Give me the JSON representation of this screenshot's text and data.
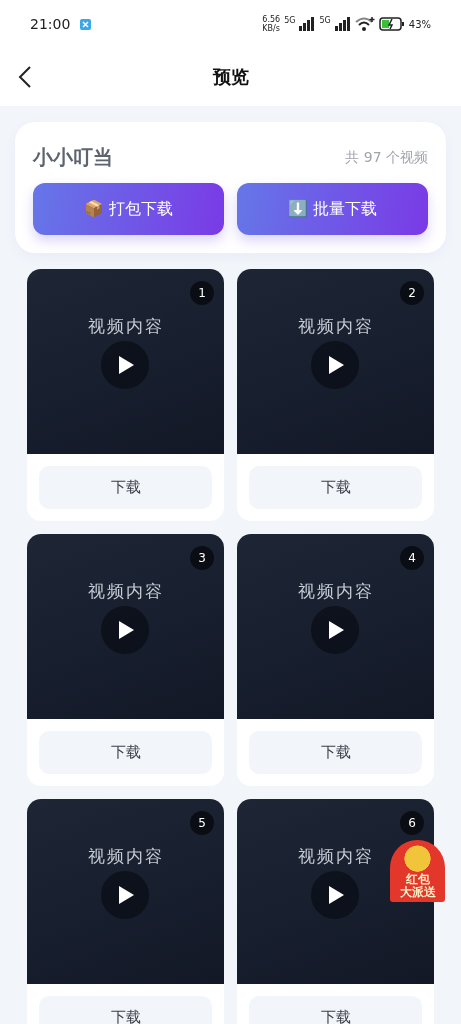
{
  "status_bar": {
    "time": "21:00",
    "net_speed": "6.56",
    "net_unit": "KB/s",
    "signal_labels": [
      "5G",
      "5G"
    ],
    "battery": "43%"
  },
  "nav": {
    "title": "预览"
  },
  "header": {
    "name": "小小叮当",
    "count": "共 97 个视频",
    "buttons": [
      {
        "icon": "📦",
        "label": "打包下载"
      },
      {
        "icon": "⬇️",
        "label": "批量下载"
      }
    ]
  },
  "videos": [
    {
      "number": "1",
      "placeholder": "视频内容",
      "button": "下载"
    },
    {
      "number": "2",
      "placeholder": "视频内容",
      "button": "下载"
    },
    {
      "number": "3",
      "placeholder": "视频内容",
      "button": "下载"
    },
    {
      "number": "4",
      "placeholder": "视频内容",
      "button": "下载"
    },
    {
      "number": "5",
      "placeholder": "视频内容",
      "button": "下载"
    },
    {
      "number": "6",
      "placeholder": "视频内容",
      "button": "下载"
    }
  ],
  "promo": {
    "lines": [
      "红包",
      "大派送"
    ]
  }
}
